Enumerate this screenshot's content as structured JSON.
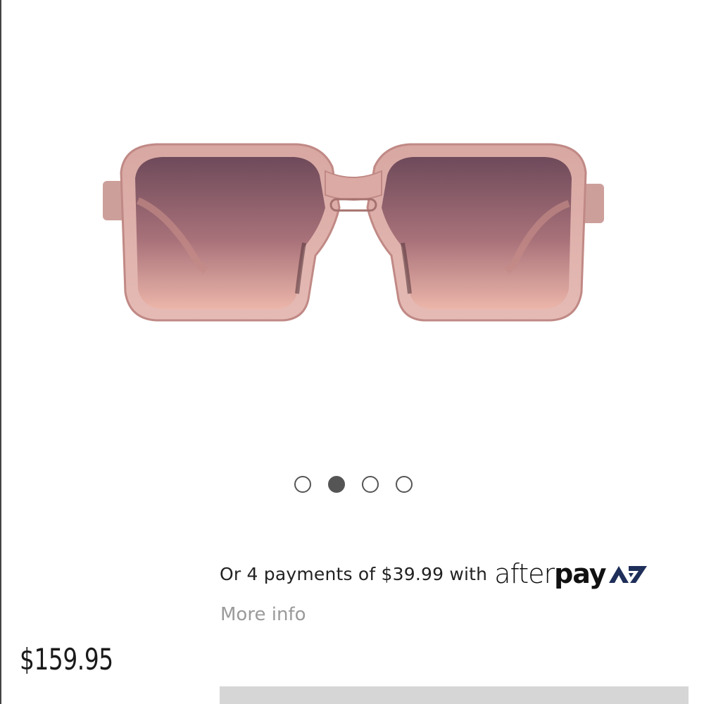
{
  "product": {
    "image_alt": "Pink translucent square sunglasses",
    "price": "$159.95"
  },
  "carousel": {
    "total": 4,
    "active_index": 1
  },
  "afterpay": {
    "text": "Or 4 payments of $39.99 with",
    "logo_after": "after",
    "logo_pay": "pay",
    "more_info": "More info",
    "brand_color": "#1a1a1a"
  },
  "colors": {
    "frame": "#d9a3a0",
    "lens_top": "#7d5a66",
    "lens_bottom": "#e8b1a6",
    "dot": "#555555",
    "bar": "#d6d6d6"
  }
}
